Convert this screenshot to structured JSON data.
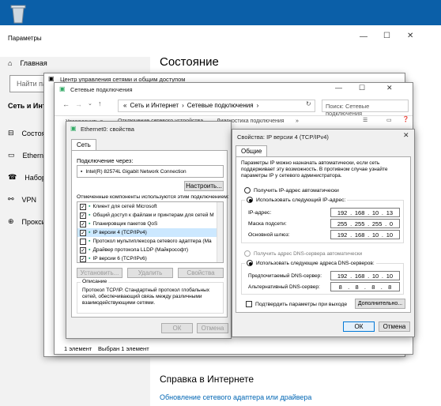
{
  "settings": {
    "title": "Параметры",
    "home": "Главная",
    "search_placeholder": "Найти пар",
    "section": "Сеть и Инте",
    "nav": [
      "Состоя",
      "Etherne",
      "Набор",
      "VPN",
      "Прокси"
    ],
    "heading": "Состояние",
    "help_heading": "Справка в Интернете",
    "help_link": "Обновление сетевого адаптера или драйвера"
  },
  "control_panel": {
    "title": "Центр управления сетями и общим доступом"
  },
  "net_connections": {
    "title": "Сетевые подключения",
    "address": [
      "Сеть и Интернет",
      "Сетевые подключения"
    ],
    "search_placeholder": "Поиск: Сетевые подключения",
    "commands": [
      "Упорядочить ▾",
      "Отключение сетевого устройства",
      "Диагностика подключения",
      "»"
    ],
    "status_count": "1 элемент",
    "status_selected": "Выбран 1 элемент"
  },
  "ethernet": {
    "title": "Ethernet0: свойства",
    "tab": "Сеть",
    "connect_via": "Подключение через:",
    "adapter": "Intel(R) 82574L Gigabit Network Connection",
    "configure": "Настроить...",
    "components_label": "Отмеченные компоненты используются этим подключением:",
    "components": [
      {
        "label": "Клиент для сетей Microsoft",
        "checked": true
      },
      {
        "label": "Общий доступ к файлам и принтерам для сетей M",
        "checked": true
      },
      {
        "label": "Планировщик пакетов QoS",
        "checked": true
      },
      {
        "label": "IP версии 4 (TCP/IPv4)",
        "checked": true,
        "selected": true
      },
      {
        "label": "Протокол мультиплексора сетевого адаптера (Ма",
        "checked": false
      },
      {
        "label": "Драйвер протокола LLDP (Майкрософт)",
        "checked": true
      },
      {
        "label": "IP версии 6 (TCP/IPv6)",
        "checked": true
      }
    ],
    "install": "Установить...",
    "remove": "Удалить",
    "properties": "Свойства",
    "description_title": "Описание",
    "description": "Протокол TCP/IP. Стандартный протокол глобальных сетей, обеспечивающий связь между различными взаимодействующими сетями.",
    "ok": "ОК",
    "cancel": "Отмена"
  },
  "ipv4": {
    "title": "Свойства: IP версии 4 (TCP/IPv4)",
    "tab": "Общие",
    "intro": "Параметры IP можно назначать автоматически, если сеть поддерживает эту возможность. В противном случае узнайте параметры IP у сетевого администратора.",
    "auto_ip": "Получить IP-адрес автоматически",
    "manual_ip": "Использовать следующий IP-адрес:",
    "ip_label": "IP-адрес:",
    "ip": [
      "192",
      "168",
      "10",
      "13"
    ],
    "mask_label": "Маска подсети:",
    "mask": [
      "255",
      "255",
      "255",
      "0"
    ],
    "gateway_label": "Основной шлюз:",
    "gateway": [
      "192",
      "168",
      "10",
      "10"
    ],
    "auto_dns": "Получить адрес DNS-сервера автоматически",
    "manual_dns": "Использовать следующие адреса DNS-серверов:",
    "dns1_label": "Предпочитаемый DNS-сервер:",
    "dns1": [
      "192",
      "168",
      "10",
      "10"
    ],
    "dns2_label": "Альтернативный DNS-сервер:",
    "dns2": [
      "8",
      "8",
      "8",
      "8"
    ],
    "validate": "Подтвердить параметры при выходе",
    "advanced": "Дополнительно...",
    "ok": "ОК",
    "cancel": "Отмена"
  },
  "colors": {
    "desktop": "#0b5fa8",
    "accent": "#0078d7",
    "link": "#0066b4",
    "selected_row": "#cce8ff"
  }
}
